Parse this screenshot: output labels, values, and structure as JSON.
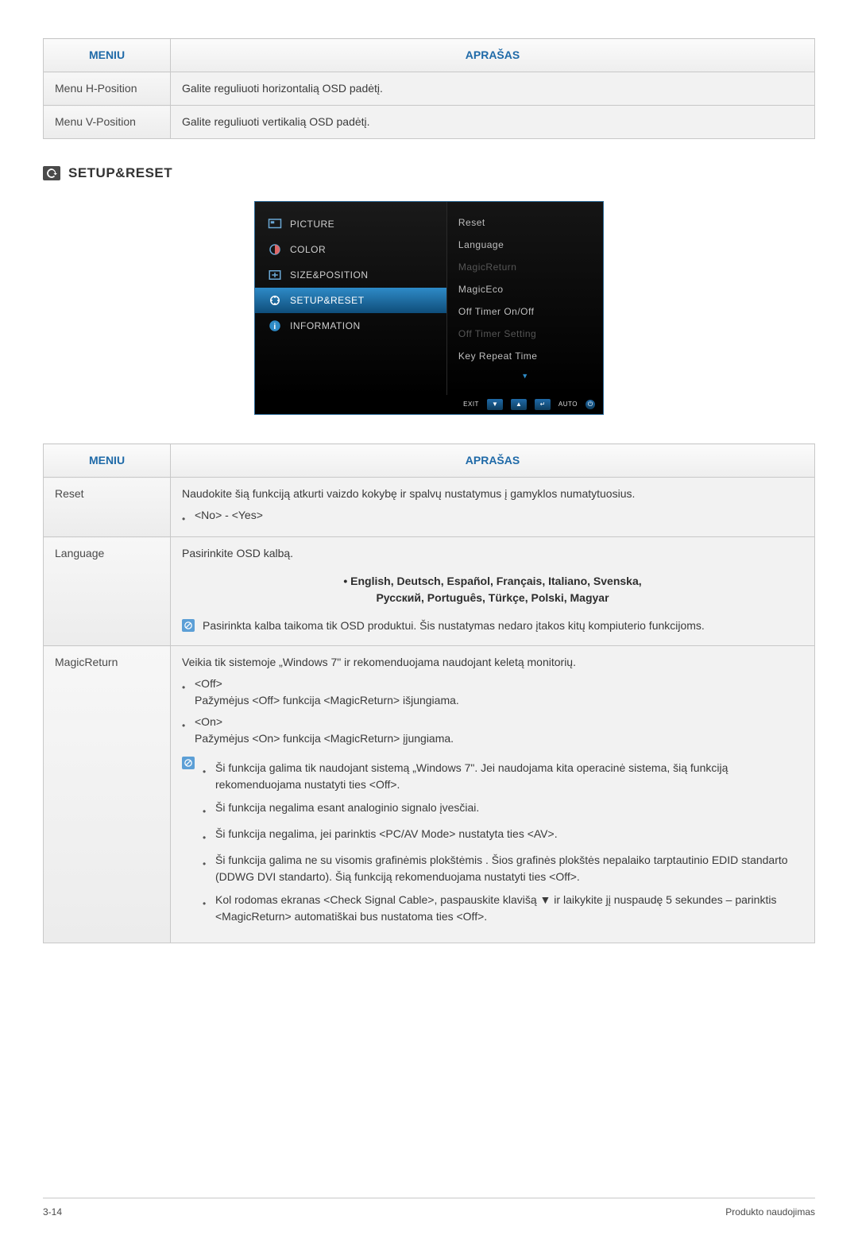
{
  "table1": {
    "header_menu": "MENIU",
    "header_desc": "APRAŠAS",
    "rows": [
      {
        "label": "Menu H-Position",
        "desc": "Galite reguliuoti horizontalią OSD padėtį."
      },
      {
        "label": "Menu V-Position",
        "desc": "Galite reguliuoti vertikalią OSD padėtį."
      }
    ]
  },
  "section_title": "SETUP&RESET",
  "osd": {
    "left": [
      {
        "label": "PICTURE",
        "icon": "picture",
        "selected": false
      },
      {
        "label": "COLOR",
        "icon": "color",
        "selected": false
      },
      {
        "label": "SIZE&POSITION",
        "icon": "size",
        "selected": false
      },
      {
        "label": "SETUP&RESET",
        "icon": "setup",
        "selected": true
      },
      {
        "label": "INFORMATION",
        "icon": "info",
        "selected": false
      }
    ],
    "right": [
      {
        "label": "Reset",
        "dim": false
      },
      {
        "label": "Language",
        "dim": false
      },
      {
        "label": "MagicReturn",
        "dim": true
      },
      {
        "label": "MagicEco",
        "dim": false
      },
      {
        "label": "Off Timer On/Off",
        "dim": false
      },
      {
        "label": "Off Timer Setting",
        "dim": true
      },
      {
        "label": "Key Repeat Time",
        "dim": false
      }
    ],
    "footer": {
      "exit": "EXIT",
      "auto": "AUTO",
      "down": "▼",
      "up": "▲",
      "enter": "↵",
      "power": "⏻"
    }
  },
  "table2": {
    "header_menu": "MENIU",
    "header_desc": "APRAŠAS",
    "reset": {
      "label": "Reset",
      "line1": "Naudokite šią funkciją atkurti vaizdo kokybę ir spalvų nustatymus į gamyklos numatytuosius.",
      "opt": "<No> - <Yes>"
    },
    "language": {
      "label": "Language",
      "line1": "Pasirinkite OSD kalbą.",
      "langs1": "• English, Deutsch, Español, Français, Italiano, Svenska,",
      "langs2": "Русский, Português, Türkçe, Polski, Magyar",
      "note": "Pasirinkta kalba taikoma tik OSD produktui. Šis nustatymas nedaro įtakos kitų kompiuterio funkcijoms."
    },
    "magicreturn": {
      "label": "MagicReturn",
      "line1": "Veikia tik sistemoje „Windows 7\" ir rekomenduojama naudojant keletą monitorių.",
      "off_title": "<Off>",
      "off_desc": "Pažymėjus <Off> funkcija <MagicReturn> išjungiama.",
      "on_title": "<On>",
      "on_desc": "Pažymėjus <On> funkcija <MagicReturn> įjungiama.",
      "n1": "Ši funkcija galima tik naudojant sistemą „Windows 7\". Jei naudojama kita operacinė sistema, šią funkciją rekomenduojama nustatyti ties <Off>.",
      "n2": "Ši funkcija negalima esant analoginio signalo įvesčiai.",
      "n3": "Ši funkcija negalima, jei parinktis <PC/AV Mode> nustatyta ties <AV>.",
      "n4": "Ši funkcija galima ne su visomis grafinėmis plokštėmis . Šios grafinės plokštės nepalaiko tarptautinio EDID standarto (DDWG DVI standarto). Šią funkciją rekomenduojama nustatyti ties <Off>.",
      "n5": "Kol rodomas ekranas <Check Signal Cable>, paspauskite klavišą ▼ ir laikykite jį nuspaudę 5 sekundes – parinktis <MagicReturn> automatiškai bus nustatoma ties <Off>."
    }
  },
  "footer": {
    "left": "3-14",
    "right": "Produkto naudojimas"
  }
}
